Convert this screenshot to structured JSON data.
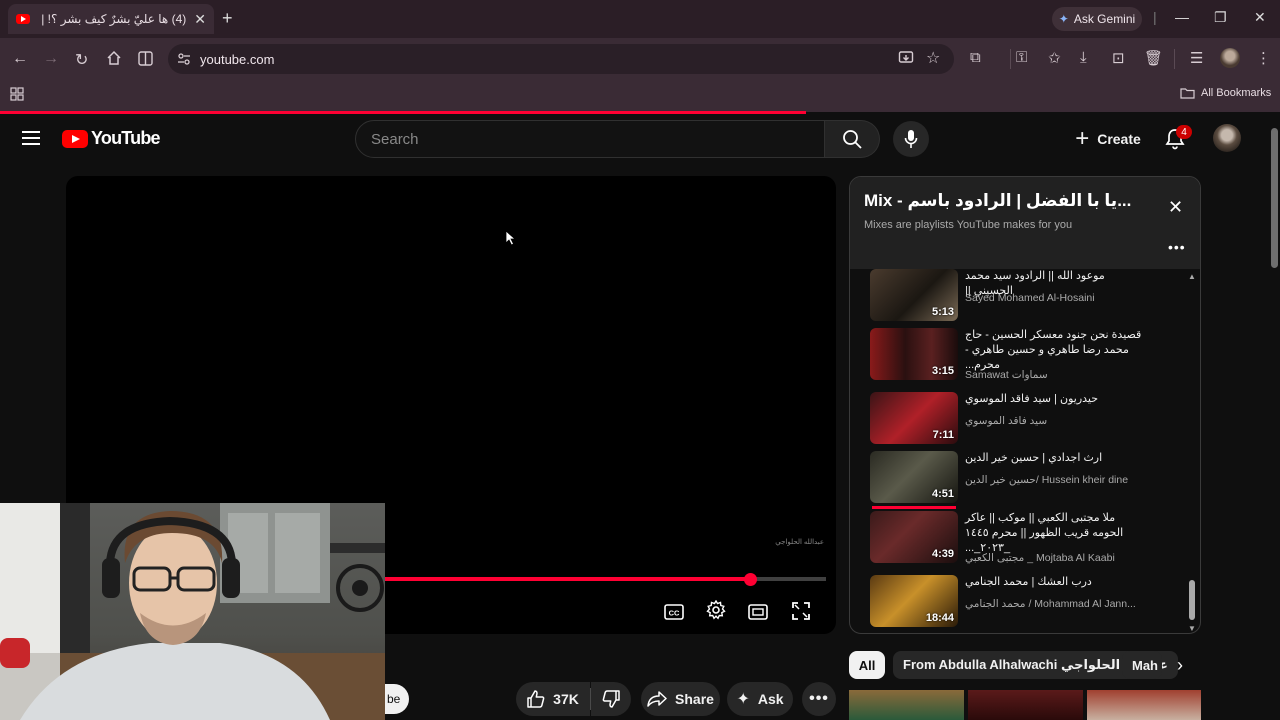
{
  "browser": {
    "tab_title": "(4) ها عليّ بشرٌ كيف بشر ؟! | محم...",
    "ask_gemini": "Ask Gemini",
    "url": "youtube.com",
    "all_bookmarks": "All Bookmarks",
    "page_load_progress": 0.63
  },
  "youtube": {
    "logo_text": "YouTube",
    "search_placeholder": "Search",
    "create_label": "Create",
    "notification_count": "4"
  },
  "player": {
    "watermark": "عبدالله الحلواجي",
    "progress": 0.9
  },
  "actions": {
    "channel_fragment": "be",
    "likes": "37K",
    "share": "Share",
    "ask": "Ask"
  },
  "playlist": {
    "title": "Mix - يا با الفضل | الرادود باسم...",
    "subtitle": "Mixes are playlists YouTube makes for you",
    "items": [
      {
        "title": "موعود الله || الرادود سيد محمد الحسيني ||",
        "channel": "Sayed Mohamed Al-Hosaini",
        "duration": "5:13"
      },
      {
        "title": "قصيدة نحن جنود معسكر الحسين - حاج محمد رضا طاهري و حسين طاهري - محرم...",
        "channel": "Samawat سماوات",
        "duration": "3:15"
      },
      {
        "title": "حيدريون | سيد فاقد الموسوي",
        "channel": "سيد فاقد الموسوي",
        "duration": "7:11"
      },
      {
        "title": "ارث اجدادي | حسين خير الدين",
        "channel": "حسين خير الدين/ Hussein kheir dine",
        "duration": "4:51"
      },
      {
        "title": "ملا مجتبى الكعبي || موكب || عاكر الحومه قريب الظهور || محرم ١٤٤٥ _٢٠٢٣_...",
        "channel": "مجتبى الكعبي _ Mojtaba Al Kaabi",
        "duration": "4:39"
      },
      {
        "title": "درب العشك | محمد الجنامي",
        "channel": "محمد الجنامي / Mohammad Al Jann...",
        "duration": "18:44"
      }
    ]
  },
  "chips": {
    "all": "All",
    "from_abdulla": "From Abdulla Alhalwachi عبدالله الحلواجي",
    "mah": "Mah"
  },
  "colors": {
    "accent_red": "#ff0033",
    "chrome_bg": "#3a2b35",
    "page_bg": "#0f0f0f"
  }
}
